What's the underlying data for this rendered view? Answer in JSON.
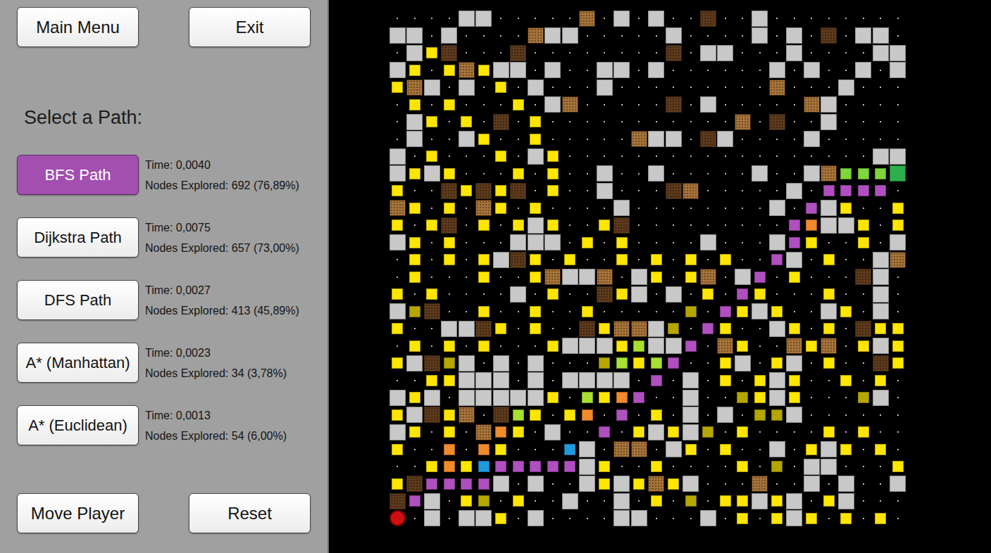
{
  "top_buttons": [
    "Main Menu",
    "Exit"
  ],
  "section_title": "Select a Path:",
  "paths": [
    {
      "label": "BFS Path",
      "selected": true,
      "time": "Time: 0,0040",
      "nodes": "Nodes Explored: 692 (76,89%)"
    },
    {
      "label": "Dijkstra Path",
      "selected": false,
      "time": "Time: 0,0075",
      "nodes": "Nodes Explored: 657 (73,00%)"
    },
    {
      "label": "DFS Path",
      "selected": false,
      "time": "Time: 0,0027",
      "nodes": "Nodes Explored: 413 (45,89%)"
    },
    {
      "label": "A* (Manhattan)",
      "selected": false,
      "time": "Time: 0,0023",
      "nodes": "Nodes Explored: 34 (3,78%)"
    },
    {
      "label": "A* (Euclidean)",
      "selected": false,
      "time": "Time: 0,0013",
      "nodes": "Nodes Explored: 54 (6,00%)"
    }
  ],
  "bottom_buttons": [
    "Move Player",
    "Reset"
  ],
  "grid": {
    "legend": [
      {
        "code": ".",
        "kind": "empty",
        "color": "#000000"
      },
      {
        "code": "W",
        "kind": "wall",
        "color": "#c8c8c8"
      },
      {
        "code": "b",
        "kind": "mud",
        "color": "#a8743a"
      },
      {
        "code": "d",
        "kind": "mud",
        "color": "#5e3b1c"
      },
      {
        "code": "y",
        "kind": "tile",
        "color": "#ffe600"
      },
      {
        "code": "p",
        "kind": "tile",
        "color": "#b04fc0"
      },
      {
        "code": "g",
        "kind": "tile",
        "color": "#7ed63a"
      },
      {
        "code": "o",
        "kind": "tile",
        "color": "#f08a2a"
      },
      {
        "code": "c",
        "kind": "tile",
        "color": "#1e9be0"
      },
      {
        "code": "v",
        "kind": "tile",
        "color": "#b5a600"
      },
      {
        "code": "l",
        "kind": "tile",
        "color": "#a8e030"
      },
      {
        "code": "G",
        "kind": "goal",
        "color": "#2db04b"
      },
      {
        "code": "S",
        "kind": "start",
        "color": "#d01010"
      }
    ],
    "rows": [
      "....WW.....b.W.W..d..W........",
      "WW.W....bWW.....W....W.W.d.WW.",
      ".Wyd...d........d.WW...W....WW",
      "Wy.ybyWW.W..WW.W......W.W..W.W",
      "ybW.W.y.W...W.........b...W...",
      ".y.y...y.Wb.....d.W.....bW....",
      ".Wy.y.d.y...........b.d..W....",
      ".W..Wy..y.....bWW.dW....W.....",
      "W.y...y.Wy..................WW",
      "WyWy...y.y..W..W.....W..WbgggG",
      "y..dydyd.y..W...db.....W.pppp.",
      "by.y.by.y....W........W.pWy..y",
      "y.yd.y.yWy..yd.........poWWy.y",
      "Wy.y...WWW.y.y....W...Wpy..y.W",
      ".y.y.yWdy.y..y.y.y.y..pW.y..Wb",
      ".y...y..ybWWb.Wy.yb.Wp.y...dW.",
      "y.y....W.y..dyW.W.y.py...y..W.",
      "Wvd..y..y..y.....v.pyWy..Wy.W.",
      "y..WWdy.y..dybbWv.py..Wy.y.dyy",
      ".y.y.y...yWWWylWWp.by..byb.yWy",
      "yWdvW.W.W...vlylp..yW.yW.y..dy",
      "..yyWWW.W.WWWW.p.W.y.yWy..y.y.",
      "WyW.WWWWWy.lyop..W..vyWy...vW.",
      "yWdyb.dly.yo.p.y.W.W.vvW......",
      "Wy.y.boy.W..p.yWyWv.y....y.y..",
      "y..o.oy...cW.bb.Wy.y..W.yWy.y.",
      "..yoycpppppWy..y....y.v.WW...y",
      "ydppppW.W..WyWybyW...b..W.W..W",
      "dpW.yv.y..W..W.y.v.yyWyW.yW...",
      "S.W.WWy.W....WW...W.y.yWy.y.y."
    ]
  }
}
